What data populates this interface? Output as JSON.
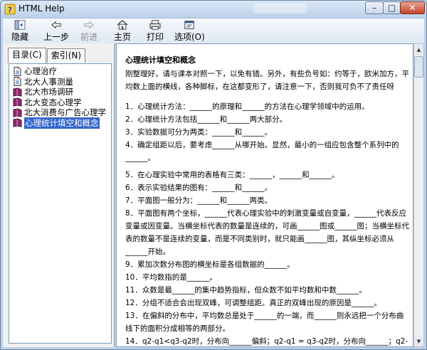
{
  "window": {
    "title": "HTML Help",
    "controls": {
      "minimize": "–",
      "maximize": "□",
      "close": "✕"
    }
  },
  "toolbar": {
    "hide": "隐藏",
    "back": "上一步",
    "forward": "前进",
    "home": "主页",
    "print": "打印",
    "options": "选项(O)"
  },
  "sidebar": {
    "tabs": [
      "目录(C)",
      "索引(N)"
    ],
    "items": [
      {
        "label": "心理治疗",
        "icon": "page-icon"
      },
      {
        "label": "北大人事测量",
        "icon": "page-icon"
      },
      {
        "label": "北大市场调研",
        "icon": "book-icon"
      },
      {
        "label": "北大变态心理学",
        "icon": "book-icon"
      },
      {
        "label": "北大消费与广告心理学",
        "icon": "book-icon"
      },
      {
        "label": "心理统计填空和概念",
        "icon": "book-icon",
        "selected": true
      }
    ]
  },
  "content": {
    "heading": "心理统计填空和概念",
    "intro": "刚整理好，请与课本对照一下，以免有错。另外，有些负号如：约等于，欧米加方，平均数上面的横线，各种脚标，在这都变形了，请注意一下，否则我可负不了责任呀",
    "questions": [
      "1．心理统计方法：______的原理和______的方法在心理学领域中的运用。",
      "2．心理统计方法包括______和______两大部分。",
      "3．实验数据可分为两类：______和______。",
      "4．确定组距以后，要考虑______从哪开始。显然，最小的一组应包含整个系列中的______。",
      "5．在心理实验中常用的表格有三类：______，______和______。",
      "6．表示实验结果的图有：______和______。",
      "7．平面图一般分为：______和______两类。",
      "8．平面图有两个坐标，______代表心理实验中的刺激变量或自变量，______代表反应变量或因变量。当横坐标代表的数量是连续的，可画______图或______图；当横坐标代表的数量不是连续的变量，而是不同类别时，就只能画______图，其纵坐标必须从______开始。",
      "9．累加次数分布图的横坐标是各组数据的______。",
      "10．平均数指的是______。",
      "11．众数是最______的集中趋势指标，但众数不如平均数和中数______。",
      "12．分组不适合会出现双峰，可调整组距。真正的双峰出现的原因是______。",
      "13．在偏斜的分布中，平均数总是处于______的一端，而______则永远把一个分布曲线下的面积分成相等的两部分。",
      "14．q2-q1<q3-q2时，分布向______偏斜；q2-q1 = q3-q2时，分布向______；q2-"
    ]
  },
  "colors": {
    "selection": "#3366cc",
    "titlebar": "#bcd1ea",
    "close_button": "#c7432b"
  }
}
